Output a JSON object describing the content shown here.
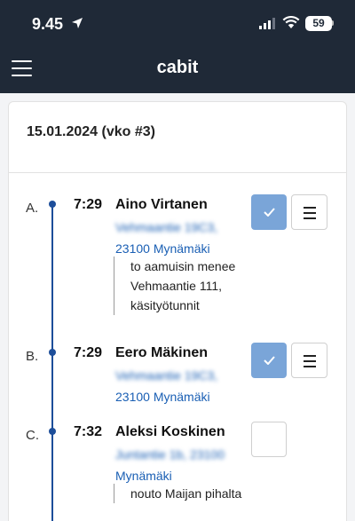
{
  "status_bar": {
    "time": "9.45",
    "battery": "59",
    "icons": [
      "location-arrow-icon",
      "signal-icon",
      "wifi-icon",
      "battery-icon"
    ]
  },
  "app": {
    "title": "cabit",
    "menu_icon": "hamburger-menu-icon"
  },
  "schedule": {
    "date_heading": "15.01.2024 (vko #3)",
    "stops": [
      {
        "letter": "A.",
        "time": "7:29",
        "name": "Aino Virtanen",
        "address_line1": "Vehmaantie 19C3,",
        "address_line2": "23100 Mynämäki",
        "note": "to aamuisin menee Vehmaantie 111, käsityötunnit",
        "done": true
      },
      {
        "letter": "B.",
        "time": "7:29",
        "name": "Eero Mäkinen",
        "address_line1": "Vehmaantie 19C3,",
        "address_line2": "23100 Mynämäki",
        "note": "",
        "done": true
      },
      {
        "letter": "C.",
        "time": "7:32",
        "name": "Aleksi Koskinen",
        "address_line1": "Juntantie 1b, 23100",
        "address_line2": "Mynämäki",
        "note": "nouto Maijan pihalta",
        "done": false
      }
    ]
  },
  "icons": {
    "check": "check-icon",
    "list": "list-icon"
  },
  "colors": {
    "header_bg": "#1f2937",
    "accent": "#1d4e9a",
    "link": "#1a5fb4",
    "check_bg": "#7aa5d8"
  }
}
